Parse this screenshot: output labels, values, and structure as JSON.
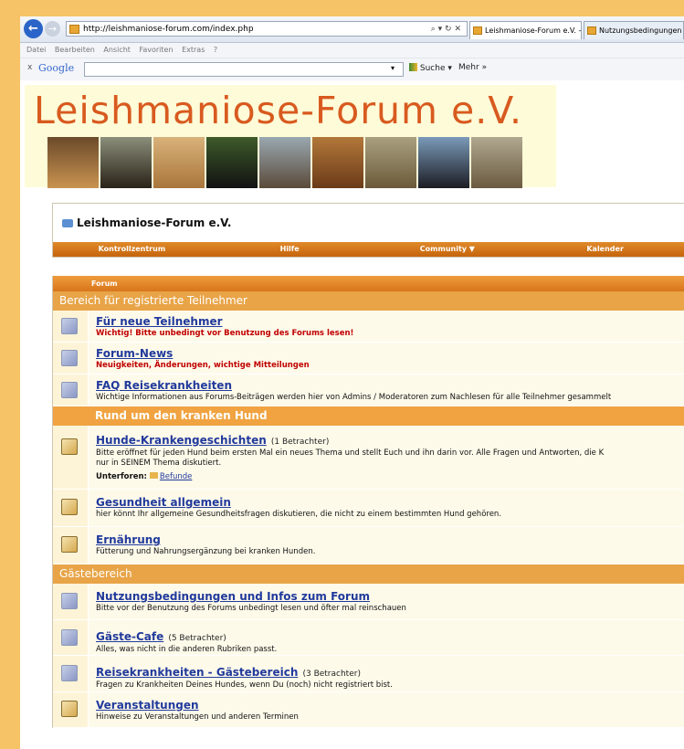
{
  "browser": {
    "url": "http://leishmaniose-forum.com/index.php",
    "url_controls": "⌕ ▾ ↻ ✕",
    "tabs": [
      {
        "label": "Leishmaniose-Forum e.V. - ...",
        "close": "✕"
      },
      {
        "label": "Nutzungsbedingungen"
      }
    ],
    "menu": [
      "Datei",
      "Bearbeiten",
      "Ansicht",
      "Favoriten",
      "Extras",
      "?"
    ],
    "google": {
      "close": "x",
      "logo": "Google",
      "search_button": "Suche",
      "more": "Mehr »"
    }
  },
  "banner": {
    "title": "Leishmaniose-Forum e.V."
  },
  "forum_header": {
    "title": "Leishmaniose-Forum e.V."
  },
  "navbar": [
    "Kontrollzentrum",
    "Hilfe",
    "Community ▼",
    "Kalender"
  ],
  "table": {
    "header": "Forum",
    "cat1": "Bereich für registrierte Teilnehmer",
    "f1": {
      "title": "Für neue Teilnehmer",
      "desc": "Wichtig! Bitte unbedingt vor Benutzung des Forums lesen!"
    },
    "f2": {
      "title": "Forum-News",
      "desc": "Neuigkeiten, Änderungen, wichtige Mitteilungen"
    },
    "f3": {
      "title": "FAQ Reisekrankheiten",
      "desc": "Wichtige Informationen aus Forums-Beiträgen werden hier von Admins / Moderatoren zum Nachlesen für alle Teilnehmer gesammelt"
    },
    "cat2": "Rund um den kranken Hund",
    "f4": {
      "title": "Hunde-Krankengeschichten",
      "viewers": "(1 Betrachter)",
      "desc1": "Bitte eröffnet für jeden Hund beim ersten Mal ein neues Thema und stellt Euch und ihn darin vor. Alle Fragen und Antworten, die K",
      "desc2": "nur in SEINEM Thema diskutiert.",
      "sub_label": "Unterforen:",
      "sub_link": "Befunde"
    },
    "f5": {
      "title": "Gesundheit allgemein",
      "desc": "hier könnt Ihr allgemeine Gesundheitsfragen diskutieren, die nicht zu einem bestimmten Hund gehören."
    },
    "f6": {
      "title": "Ernährung",
      "desc": "Fütterung und Nahrungsergänzung bei kranken Hunden."
    },
    "cat3": "Gästebereich",
    "f7": {
      "title": "Nutzungsbedingungen und Infos zum Forum",
      "desc": "Bitte vor der Benutzung des Forums unbedingt lesen und öfter mal reinschauen"
    },
    "f8": {
      "title": "Gäste-Cafe",
      "viewers": "(5 Betrachter)",
      "desc": "Alles, was nicht in die anderen Rubriken passt."
    },
    "f9": {
      "title": "Reisekrankheiten - Gästebereich",
      "viewers": "(3 Betrachter)",
      "desc": "Fragen zu Krankheiten Deines Hundes, wenn Du (noch) nicht registriert bist."
    },
    "f10": {
      "title": "Veranstaltungen",
      "desc": "Hinweise zu Veranstaltungen und anderen Terminen"
    }
  }
}
